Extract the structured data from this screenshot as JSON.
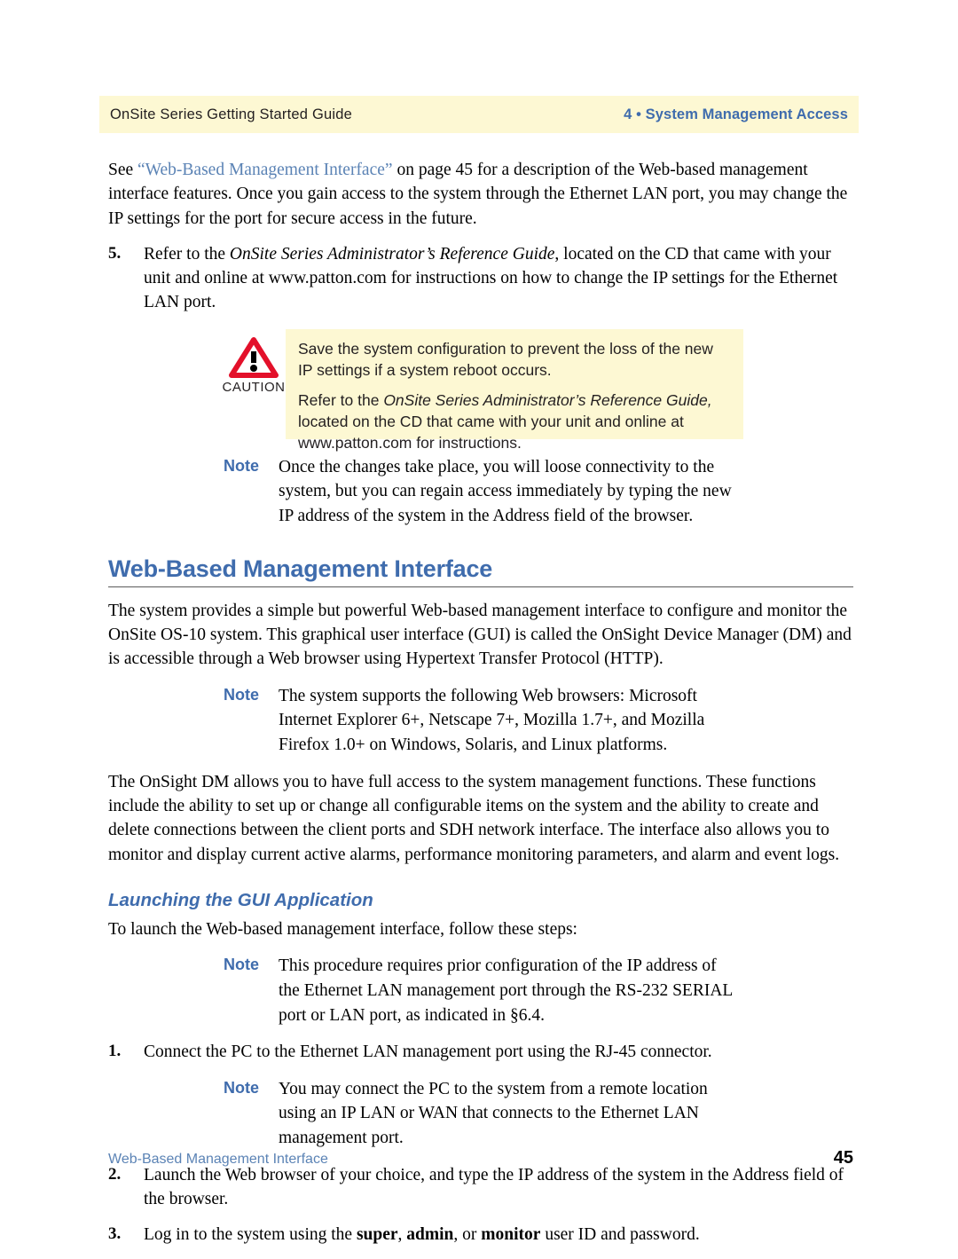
{
  "header": {
    "left_text": "OnSite Series Getting Started Guide",
    "right_text": "4 • System Management Access",
    "band_color": "#fdf8d3",
    "accent_color": "#3f6cad"
  },
  "intro_paragraph": {
    "lead": "See ",
    "link": "“Web-Based Management Interface”",
    "rest": " on page 45 for a description of the Web-based management interface features. Once you gain access to the system through the Ethernet LAN port, you may change the IP settings for the port for secure access in the future."
  },
  "step_five": {
    "number": "5.",
    "part1": "Refer to the ",
    "italic": "OnSite Series Administrator’s Reference Guide",
    "part2": ", located on the CD that came with your unit and online at www.patton.com for instructions on how to change the IP settings for the Ethernet LAN port."
  },
  "caution": {
    "label": "CAUTION",
    "icon": "warning-triangle-icon",
    "triangle_color": "#e3102a",
    "background": "#fdf8d3",
    "paragraph1": "Save the system configuration to prevent the loss of the new IP settings if a system reboot occurs.",
    "paragraph2_part1": "Refer to the ",
    "paragraph2_italic": "OnSite Series Administrator’s Reference Guide,",
    "paragraph2_part2": " located on the CD that came with your unit and online at www.patton.com for instructions."
  },
  "note_connectivity": {
    "label": "Note",
    "text": "Once the changes take place, you will loose connectivity to the system, but you can regain access immediately by typing the new IP address of the system in the Address field of the browser."
  },
  "section": {
    "heading": "Web-Based Management Interface",
    "paragraph": "The system provides a simple but powerful Web-based management interface to configure and monitor the OnSite OS-10 system. This graphical user interface (GUI) is called the OnSight Device Manager (DM) and is accessible through a Web browser using Hypertext Transfer Protocol (HTTP)."
  },
  "note_browsers": {
    "label": "Note",
    "text": "The system supports the following Web browsers: Microsoft Internet Explorer 6+, Netscape 7+, Mozilla 1.7+, and Mozilla Firefox 1.0+ on Windows, Solaris, and Linux platforms."
  },
  "dm_paragraph": {
    "text": "The OnSight DM allows you to have full access to the system management functions. These functions include the ability to set up or change all configurable items on the system and the ability to create and delete connections between the client ports and SDH network interface. The interface also allows you to monitor and display current active alarms, performance monitoring parameters, and alarm and event logs."
  },
  "subsection": {
    "heading": "Launching the GUI Application",
    "intro": "To launch the Web-based management interface, follow these steps:"
  },
  "note_ip_config": {
    "label": "Note",
    "text": "This procedure requires prior configuration of the IP address of the Ethernet LAN management port through the RS-232 SERIAL port or LAN port, as indicated in §6.4."
  },
  "step_one": {
    "number": "1.",
    "text": "Connect the PC to the Ethernet LAN management port using the RJ-45 connector."
  },
  "note_remote": {
    "label": "Note",
    "text": "You may connect the PC to the system from a remote location using an IP LAN or WAN that connects to the Ethernet LAN management port."
  },
  "step_two": {
    "number": "2.",
    "text": "Launch the Web browser of your choice, and type the IP address of the system in the Address field of the browser."
  },
  "step_three": {
    "number": "3.",
    "part1": "Log in to the system using the ",
    "bold1": "super",
    "part2": ", ",
    "bold2": "admin",
    "part3": ", or ",
    "bold3": "monitor",
    "part4": " user ID and password."
  },
  "footer": {
    "left_text": "Web-Based Management Interface",
    "page_number": "45"
  }
}
